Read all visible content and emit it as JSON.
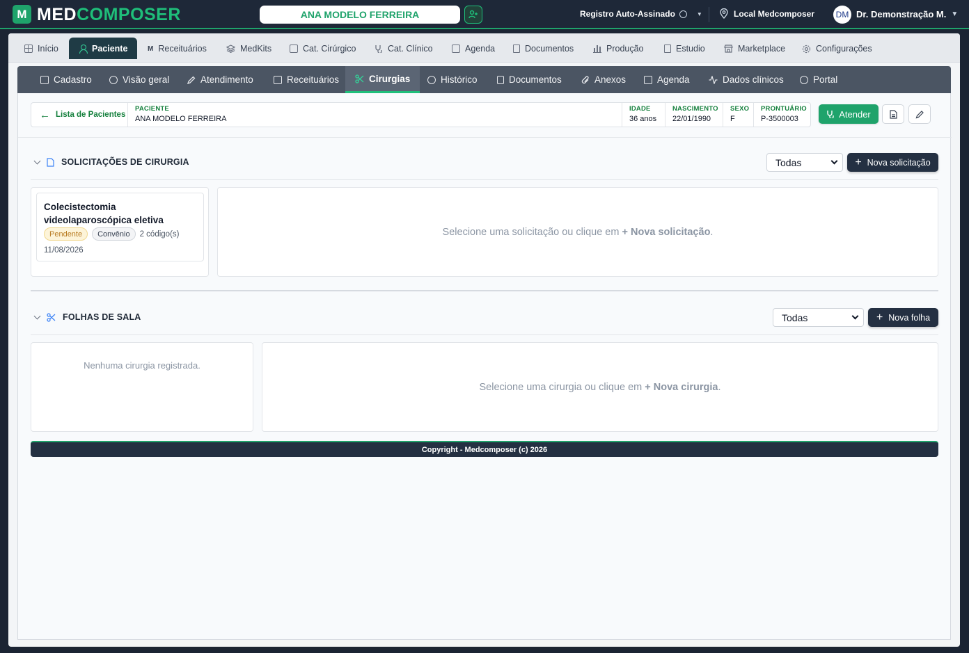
{
  "topbar": {
    "brand_med": "MED",
    "brand_composer": "COMPOSER",
    "logo_letter": "M",
    "patient_name": "ANA MODELO FERREIRA",
    "registro": "Registro Auto-Assinado",
    "local": "Local Medcomposer",
    "avatar_initials": "DM",
    "doctor": "Dr. Demonstração M."
  },
  "main_nav": [
    {
      "label": "Início"
    },
    {
      "label": "Paciente"
    },
    {
      "label": "Receituários"
    },
    {
      "label": "MedKits"
    },
    {
      "label": "Cat. Cirúrgico"
    },
    {
      "label": "Cat. Clínico"
    },
    {
      "label": "Agenda"
    },
    {
      "label": "Documentos"
    },
    {
      "label": "Produção"
    },
    {
      "label": "Estudio"
    },
    {
      "label": "Marketplace"
    },
    {
      "label": "Configurações"
    }
  ],
  "sub_nav": [
    {
      "label": "Cadastro"
    },
    {
      "label": "Visão geral"
    },
    {
      "label": "Atendimento"
    },
    {
      "label": "Receituários"
    },
    {
      "label": "Cirurgias"
    },
    {
      "label": "Histórico"
    },
    {
      "label": "Documentos"
    },
    {
      "label": "Anexos"
    },
    {
      "label": "Agenda"
    },
    {
      "label": "Dados clínicos"
    },
    {
      "label": "Portal"
    }
  ],
  "patient_strip": {
    "back_label": "Lista de Pacientes",
    "paciente_label": "PACIENTE",
    "paciente_value": "ANA MODELO FERREIRA",
    "idade_label": "IDADE",
    "idade_value": "36 anos",
    "nascimento_label": "NASCIMENTO",
    "nascimento_value": "22/01/1990",
    "sexo_label": "SEXO",
    "sexo_value": "F",
    "prontuario_label": "PRONTUÁRIO",
    "prontuario_value": "P-3500003",
    "atender_label": "Atender"
  },
  "solicitacoes": {
    "title": "SOLICITAÇÕES DE CIRURGIA",
    "filter_value": "Todas",
    "new_button": "Nova solicitação",
    "card": {
      "title": "Colecistectomia videolaparoscópica eletiva",
      "status": "Pendente",
      "type": "Convênio",
      "codes": "2 código(s)",
      "date": "11/08/2026"
    },
    "empty_prefix": "Selecione uma solicitação ou clique em",
    "empty_plus": "+",
    "empty_action": "Nova solicitação",
    "empty_suffix": "."
  },
  "folhas": {
    "title": "FOLHAS DE SALA",
    "filter_value": "Todas",
    "new_button": "Nova folha",
    "list_empty": "Nenhuma cirurgia registrada.",
    "empty_prefix": "Selecione uma cirurgia ou clique em",
    "empty_plus": "+",
    "empty_action": "Nova cirurgia",
    "empty_suffix": "."
  },
  "footer": "Copyright - Medcomposer (c) 2026",
  "colors": {
    "brand_green": "#1fa36b",
    "topbar_bg": "#1e2838",
    "subnav_bg": "#4b5563",
    "dark_button": "#243042"
  }
}
